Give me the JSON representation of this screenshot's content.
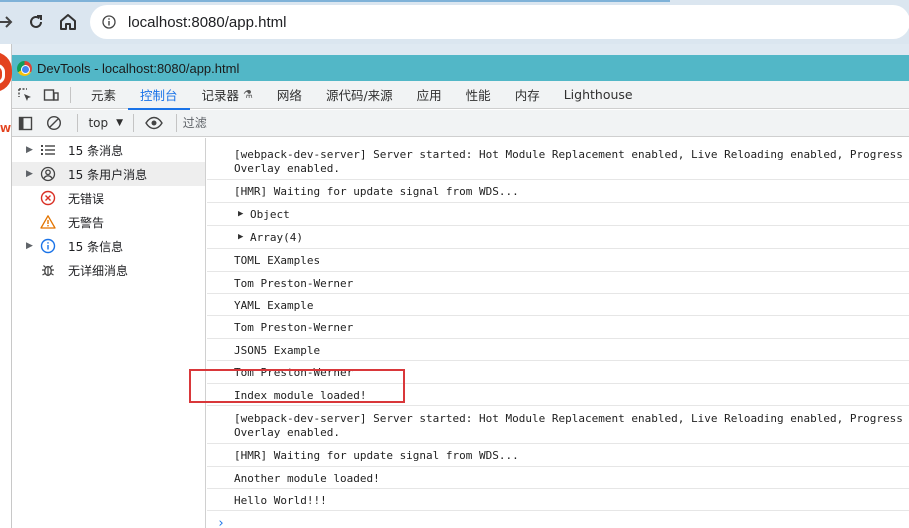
{
  "browser": {
    "url": "localhost:8080/app.html"
  },
  "devtools": {
    "window_title": "DevTools - localhost:8080/app.html",
    "tabs": [
      {
        "label": "元素"
      },
      {
        "label": "控制台",
        "active": true
      },
      {
        "label": "记录器"
      },
      {
        "label": "网络"
      },
      {
        "label": "源代码/来源"
      },
      {
        "label": "应用"
      },
      {
        "label": "性能"
      },
      {
        "label": "内存"
      },
      {
        "label": "Lighthouse"
      }
    ],
    "toolbar": {
      "context": "top",
      "filter_placeholder": "过滤"
    },
    "sidebar": {
      "items": [
        {
          "label": "15 条消息",
          "icon": "list-icon"
        },
        {
          "label": "15 条用户消息",
          "icon": "user-icon"
        },
        {
          "label": "无错误",
          "icon": "error-icon"
        },
        {
          "label": "无警告",
          "icon": "warning-icon"
        },
        {
          "label": "15 条信息",
          "icon": "info-icon"
        },
        {
          "label": "无详细消息",
          "icon": "bug-icon"
        }
      ]
    },
    "console": {
      "messages": [
        "[webpack-dev-server] Server started: Hot Module Replacement enabled, Live Reloading enabled, Progress d",
        "Overlay enabled.",
        "[HMR] Waiting for update signal from WDS...",
        "Object",
        "Array(4)",
        "TOML EXamples",
        "Tom Preston-Werner",
        "YAML Example",
        "Tom Preston-Werner",
        "JSON5 Example",
        "Tom Preston-Werner",
        "Index module loaded!",
        "[webpack-dev-server] Server started: Hot Module Replacement enabled, Live Reloading enabled, Progress d",
        "Overlay enabled.",
        "[HMR] Waiting for update signal from WDS...",
        "Another module loaded!",
        "Hello World!!!"
      ],
      "prompt": "›"
    },
    "colors": {
      "accent": "#1a73e8",
      "titlebar": "#52b7c7",
      "highlight": "#d9373a",
      "error": "#d93025",
      "warning": "#e37400"
    }
  }
}
